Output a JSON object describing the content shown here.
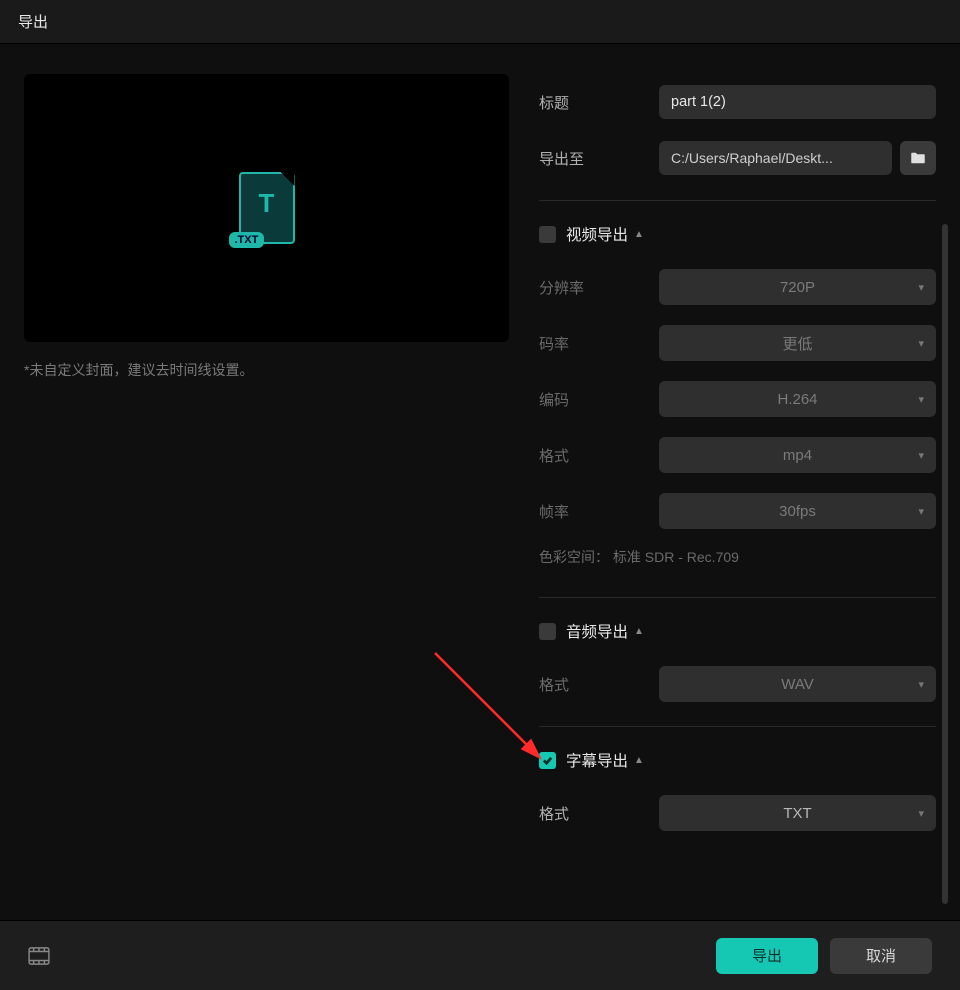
{
  "window_title": "导出",
  "preview": {
    "hint": "*未自定义封面，建议去时间线设置。",
    "badge": ".TXT"
  },
  "fields": {
    "title_label": "标题",
    "title_value": "part 1(2)",
    "export_to_label": "导出至",
    "export_to_value": "C:/Users/Raphael/Deskt..."
  },
  "sections": {
    "video": {
      "title": "视频导出",
      "checked": false,
      "resolution_label": "分辨率",
      "resolution_value": "720P",
      "bitrate_label": "码率",
      "bitrate_value": "更低",
      "codec_label": "编码",
      "codec_value": "H.264",
      "format_label": "格式",
      "format_value": "mp4",
      "fps_label": "帧率",
      "fps_value": "30fps",
      "colorspace_label": "色彩空间：",
      "colorspace_value": "标准 SDR - Rec.709"
    },
    "audio": {
      "title": "音频导出",
      "checked": false,
      "format_label": "格式",
      "format_value": "WAV"
    },
    "subtitle": {
      "title": "字幕导出",
      "checked": true,
      "format_label": "格式",
      "format_value": "TXT"
    }
  },
  "footer": {
    "export_label": "导出",
    "cancel_label": "取消"
  }
}
